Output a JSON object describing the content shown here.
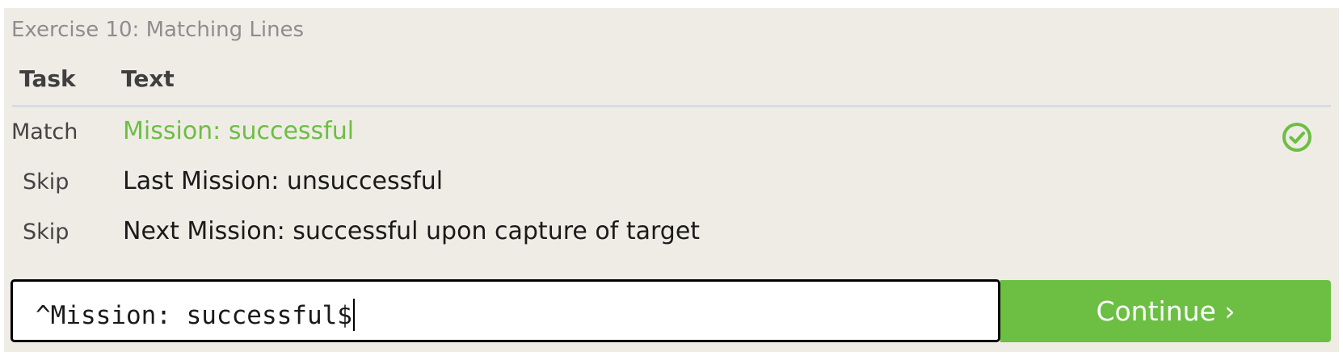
{
  "exercise": {
    "title": "Exercise 10: Matching Lines"
  },
  "table": {
    "headers": {
      "task": "Task",
      "text": "Text"
    },
    "rows": [
      {
        "task": "Match",
        "text": "Mission: successful",
        "status": "success",
        "icon": "check-circle-icon"
      },
      {
        "task": "Skip",
        "text": "Last Mission: unsuccessful"
      },
      {
        "task": "Skip",
        "text": "Next Mission: successful upon capture of target"
      }
    ]
  },
  "input": {
    "value": "^Mission: successful$"
  },
  "continue_button": {
    "label": "Continue ›"
  },
  "colors": {
    "panel_bg": "#efece6",
    "accent_green": "#6cbf43",
    "title_gray": "#8e8e8e",
    "divider": "#d5dde4"
  }
}
